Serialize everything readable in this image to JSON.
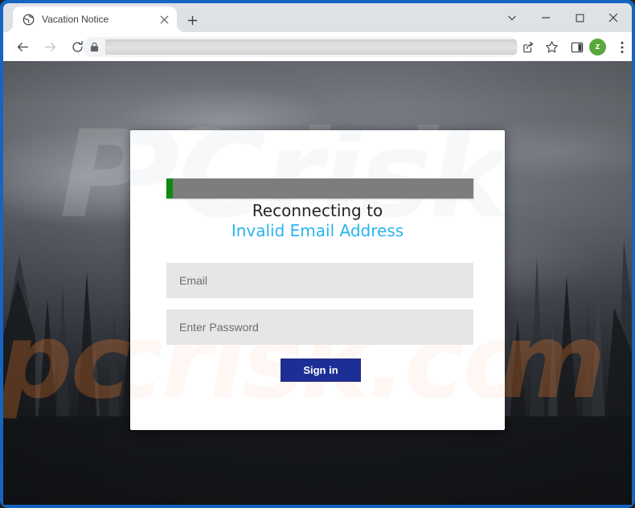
{
  "browser": {
    "tab": {
      "title": "Vacation Notice",
      "favicon": "globe-icon",
      "close": "×"
    },
    "new_tab_label": "+",
    "window_controls": {
      "more": "chevron-down-icon",
      "minimize": "minimize-icon",
      "maximize": "maximize-icon",
      "close": "close-icon"
    },
    "toolbar": {
      "back": "back-arrow-icon",
      "forward": "forward-arrow-icon",
      "reload": "reload-icon",
      "lock": "lock-icon",
      "url_value": "",
      "url_placeholder": "",
      "share": "share-icon",
      "bookmark": "star-icon",
      "side_panel": "side-panel-icon",
      "profile_initial": "z",
      "menu": "three-dot-menu-icon"
    },
    "frame_color": "#1565c0",
    "tabstrip_color": "#dee1e6"
  },
  "page": {
    "watermark": {
      "top_text": "PCrisk",
      "bottom_text": "pcrisk.com"
    },
    "card": {
      "progress": {
        "label": "loading-progress",
        "percent": 2,
        "fill_color": "#108a10",
        "track_color": "#7d7d7d"
      },
      "status_line_1": "Reconnecting to",
      "status_line_2": "Invalid Email Address",
      "status_line_2_color": "#29b3f0",
      "email": {
        "value": "",
        "placeholder": "Email"
      },
      "password": {
        "value": "",
        "placeholder": "Enter Password"
      },
      "signin_label": "Sign in",
      "signin_color": "#1c2f96"
    }
  }
}
